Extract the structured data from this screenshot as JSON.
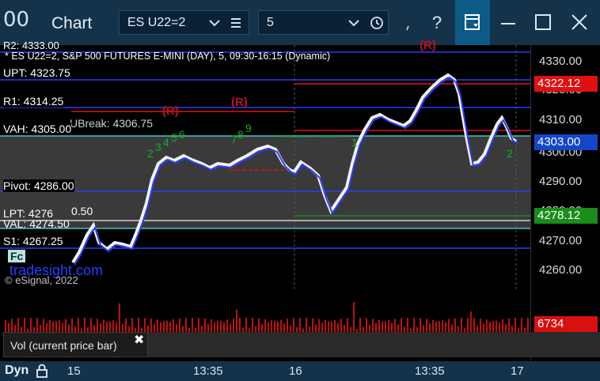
{
  "titlebar": {
    "app_icon": "00",
    "title": "Chart",
    "symbol": "ES U22=2",
    "interval": "5",
    "icons": [
      "chevron-down-icon",
      "menu-icon",
      "clock-icon",
      "link-icon",
      "help-icon",
      "layout-icon",
      "minimize-icon",
      "maximize-icon",
      "close-icon"
    ],
    "help_glyph": "?",
    "active_color": "#0d5a86"
  },
  "chart": {
    "header": "* ES U22=2, S&P 500 FUTURES E-MINI (DAY), 5, 09:30-16:15 (Dynamic)",
    "top_partial": "R2: 4333.00",
    "levels": [
      {
        "label": "UPT: 4323.75",
        "price": 4323.75,
        "color": "#2b3cff"
      },
      {
        "label": "R1: 4314.25",
        "price": 4314.25,
        "color": "#2b3cff"
      },
      {
        "label": "VAH: 4305.00",
        "price": 4305.0,
        "color": "#2b3cff"
      },
      {
        "label": "Pivot: 4286.00",
        "price": 4286.0,
        "color": "#2b3cff"
      },
      {
        "label": "LPT: 4276",
        "price": 4276.0,
        "color": "#2b3cff"
      },
      {
        "label": "VAL: 4274.50",
        "price": 4274.5,
        "color": "#2b3cff"
      },
      {
        "label": "S1: 4267.25",
        "price": 4267.25,
        "color": "#2b3cff"
      }
    ],
    "overlap_fragments": [
      "UBreak: 4306.75",
      "0.50",
      ".50"
    ],
    "r_markers": [
      "(R)",
      "(R)",
      "(R)"
    ],
    "watermark": "tradesight.com",
    "watermark_partial": "Fc",
    "copyright": "© eSignal, 2022",
    "seq_labels": [
      "2",
      "3",
      "4",
      "5",
      "6",
      "7",
      "8",
      "9",
      "1",
      "2"
    ]
  },
  "price_axis": {
    "ticks": [
      "4330.00",
      "4320.00",
      "4310.00",
      "4300.00",
      "4290.00",
      "4280.00",
      "4270.00",
      "4260.00"
    ],
    "tag_high": "4322.12",
    "tag_current": "4303.00",
    "tag_low": "4278.12",
    "tag_vol": "6734",
    "colors": {
      "high": "#e01010",
      "current": "#1446c8",
      "low": "#1a8c1a",
      "vol": "#d81010"
    }
  },
  "volume": {
    "tooltip": "Vol (current price bar)",
    "close_glyph": "✖"
  },
  "timebar": {
    "mode": "Dyn",
    "labels": [
      "15",
      "13:35",
      "16",
      "13:35",
      "17"
    ]
  }
}
